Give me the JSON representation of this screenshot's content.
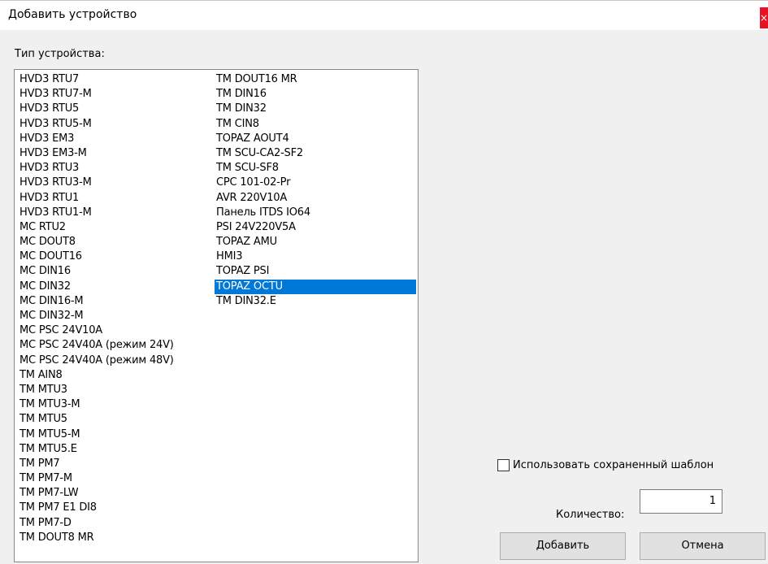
{
  "window": {
    "title": "Добавить устройство",
    "close_label": "×"
  },
  "device_type_label": "Тип устройства:",
  "device_list": {
    "column1": [
      "HVD3 RTU7",
      "HVD3 RTU7-M",
      "HVD3 RTU5",
      "HVD3 RTU5-M",
      "HVD3 EM3",
      "HVD3 EM3-M",
      "HVD3 RTU3",
      "HVD3 RTU3-M",
      "HVD3 RTU1",
      "HVD3 RTU1-M",
      "MC RTU2",
      "MC DOUT8",
      "MC DOUT16",
      "MC DIN16",
      "MC DIN32",
      "MC DIN16-M",
      "MC DIN32-M",
      "MC PSC 24V10A",
      "MC PSC 24V40A (режим 24V)",
      "MC PSC 24V40A (режим 48V)",
      "TM AIN8",
      "TM MTU3",
      "TM MTU3-M",
      "TM MTU5",
      "TM MTU5-M",
      "TM MTU5.E",
      "TM PM7",
      "TM PM7-M",
      "TM PM7-LW",
      "TM PM7 E1 DI8",
      "TM PM7-D",
      "TM DOUT8 MR"
    ],
    "column2": [
      "TM DOUT16 MR",
      "TM DIN16",
      "TM DIN32",
      "TM CIN8",
      "TOPAZ AOUT4",
      "TM SCU-CA2-SF2",
      "TM SCU-SF8",
      "CPC 101-02-Pr",
      "AVR 220V10A",
      "Панель ITDS IO64",
      "PSI 24V220V5A",
      "TOPAZ AMU",
      "HMI3",
      "TOPAZ PSI",
      "TOPAZ OCTU",
      "TM DIN32.E"
    ],
    "selected": "TOPAZ OCTU",
    "selection_color": "#0078d7"
  },
  "use_template": {
    "label": "Использовать сохраненный шаблон",
    "checked": false
  },
  "quantity": {
    "label": "Количество:",
    "value": "1"
  },
  "buttons": {
    "add": "Добавить",
    "cancel": "Отмена"
  }
}
